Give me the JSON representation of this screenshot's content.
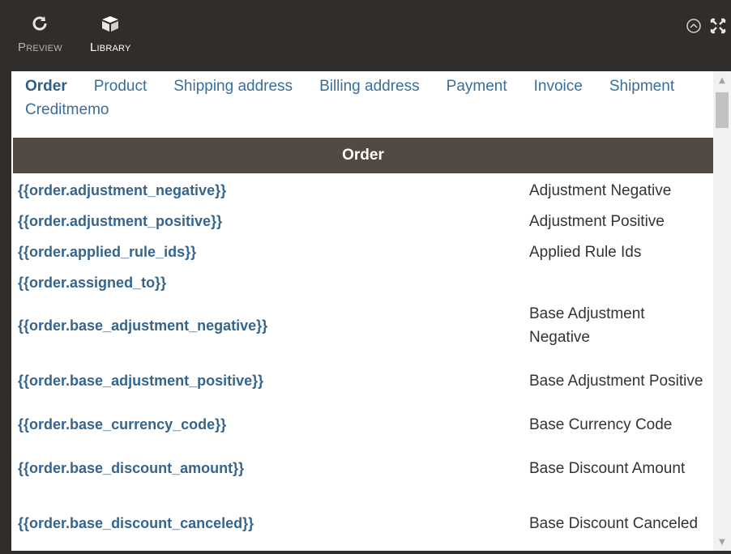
{
  "toolbar": {
    "preview_label": "Preview",
    "library_label": "Library",
    "preview_icon": "refresh-icon",
    "library_icon": "box-icon",
    "collapse_icon": "collapse-icon",
    "fullscreen_icon": "fullscreen-icon"
  },
  "tabs": [
    {
      "label": "Order",
      "active": true
    },
    {
      "label": "Product"
    },
    {
      "label": "Shipping address"
    },
    {
      "label": "Billing address"
    },
    {
      "label": "Payment"
    },
    {
      "label": "Invoice"
    },
    {
      "label": "Shipment"
    },
    {
      "label": "Creditmemo"
    }
  ],
  "section": {
    "title": "Order"
  },
  "rows": [
    {
      "var": "{{order.adjustment_negative}}",
      "desc": "Adjustment Negative"
    },
    {
      "var": "{{order.adjustment_positive}}",
      "desc": "Adjustment Positive"
    },
    {
      "var": "{{order.applied_rule_ids}}",
      "desc": "Applied Rule Ids"
    },
    {
      "var": "{{order.assigned_to}}",
      "desc": ""
    },
    {
      "var": "{{order.base_adjustment_negative}}",
      "desc": "Base Adjustment Negative"
    },
    {
      "var": "{{order.base_adjustment_positive}}",
      "desc": "Base Adjustment Positive"
    },
    {
      "var": "{{order.base_currency_code}}",
      "desc": "Base Currency Code"
    },
    {
      "var": "{{order.base_discount_amount}}",
      "desc": "Base Discount Amount"
    },
    {
      "var": "{{order.base_discount_canceled}}",
      "desc": "Base Discount Canceled"
    }
  ],
  "colors": {
    "toolbar_bg": "#302d2a",
    "header_bg": "#514943",
    "link": "#35658f"
  }
}
